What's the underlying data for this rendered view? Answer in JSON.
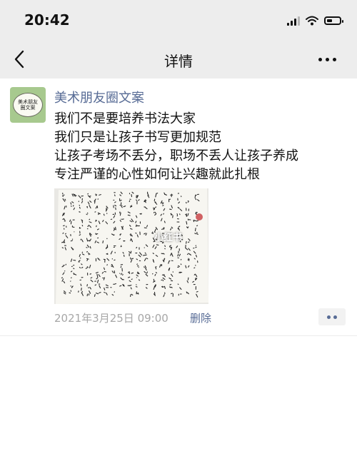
{
  "status_bar": {
    "time": "20:42",
    "battery_level": 0.45
  },
  "nav": {
    "title": "详情",
    "back_icon": "chevron-left-icon",
    "more_icon": "more-dots-icon"
  },
  "post": {
    "avatar_text_line1": "美术朋友",
    "avatar_text_line2": "圈文案",
    "username": "美术朋友圈文案",
    "lines": [
      "我们不是要培养书法大家",
      "我们只是让孩子书写更加规范",
      "让孩子考场不丢分，职场不丢人让孩子养成",
      "专注严谨的心性如何让兴趣就此扎根"
    ],
    "photo_watermark": "小红书",
    "date": "2021年3月25日 09:00",
    "delete_label": "删除",
    "comment_icon": "comment-dots-icon"
  },
  "colors": {
    "link": "#576b95",
    "header_bg": "#ededed",
    "meta": "#a7a7a7"
  }
}
